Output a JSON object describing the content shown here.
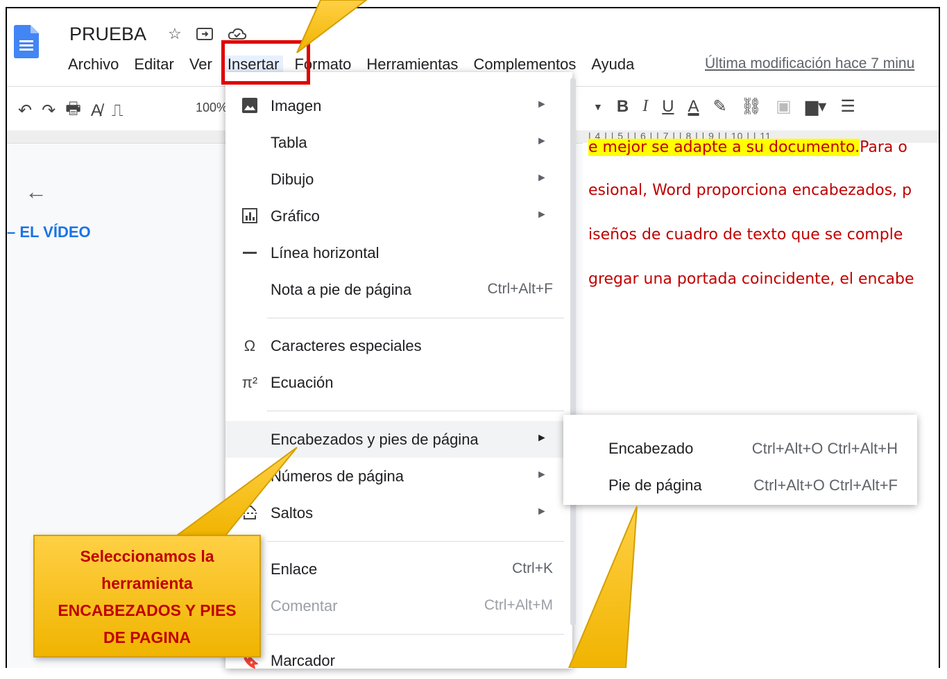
{
  "document": {
    "title": "PRUEBA"
  },
  "menubar": {
    "items": [
      "Archivo",
      "Editar",
      "Ver",
      "Insertar",
      "Formato",
      "Herramientas",
      "Complementos",
      "Ayuda"
    ],
    "last_modified": "Última modificación hace 7 minu"
  },
  "toolbar": {
    "zoom": "100%"
  },
  "ruler": "| 4 | | 5 | | 6 | | 7 | | 8 | | 9 | | 10 | | 11",
  "outline": {
    "heading": "EL VÍDEO"
  },
  "doc_lines": [
    "e mejor se adapte a su documento.",
    "Para o",
    "esional, Word proporciona encabezados, p",
    "iseños de cuadro de texto que se comple",
    "gregar una portada coincidente, el encabe"
  ],
  "insert_menu": {
    "items": [
      {
        "label": "Imagen",
        "icon": "image-icon",
        "submenu": true
      },
      {
        "label": "Tabla",
        "submenu": true
      },
      {
        "label": "Dibujo",
        "submenu": true
      },
      {
        "label": "Gráfico",
        "icon": "chart-icon",
        "submenu": true
      },
      {
        "label": "Línea horizontal",
        "icon": "horizontal-line-icon"
      },
      {
        "label": "Nota a pie de página",
        "shortcut": "Ctrl+Alt+F"
      },
      {
        "label": "Caracteres especiales",
        "icon": "omega-icon"
      },
      {
        "label": "Ecuación",
        "icon": "pi-icon"
      },
      {
        "label": "Encabezados y pies de página",
        "submenu": true,
        "highlighted": true
      },
      {
        "label": "Números de página",
        "submenu": true
      },
      {
        "label": "Saltos",
        "icon": "page-break-icon",
        "submenu": true
      },
      {
        "label": "Enlace",
        "icon": "link-icon",
        "shortcut": "Ctrl+K"
      },
      {
        "label": "Comentar",
        "icon": "comment-icon",
        "shortcut": "Ctrl+Alt+M",
        "disabled": true
      },
      {
        "label": "Marcador",
        "icon": "bookmark-icon"
      }
    ]
  },
  "submenu": {
    "items": [
      {
        "label": "Encabezado",
        "shortcut": "Ctrl+Alt+O Ctrl+Alt+H"
      },
      {
        "label": "Pie de página",
        "shortcut": "Ctrl+Alt+O Ctrl+Alt+F"
      }
    ]
  },
  "callout": {
    "lines": [
      "Seleccionamos la",
      "herramienta",
      "ENCABEZADOS Y PIES",
      "DE PAGINA"
    ]
  },
  "colors": {
    "accent": "#1a73e8",
    "annotation_red": "#e00000",
    "callout_yellow": "#ffc000",
    "doc_text": "#c00000"
  }
}
